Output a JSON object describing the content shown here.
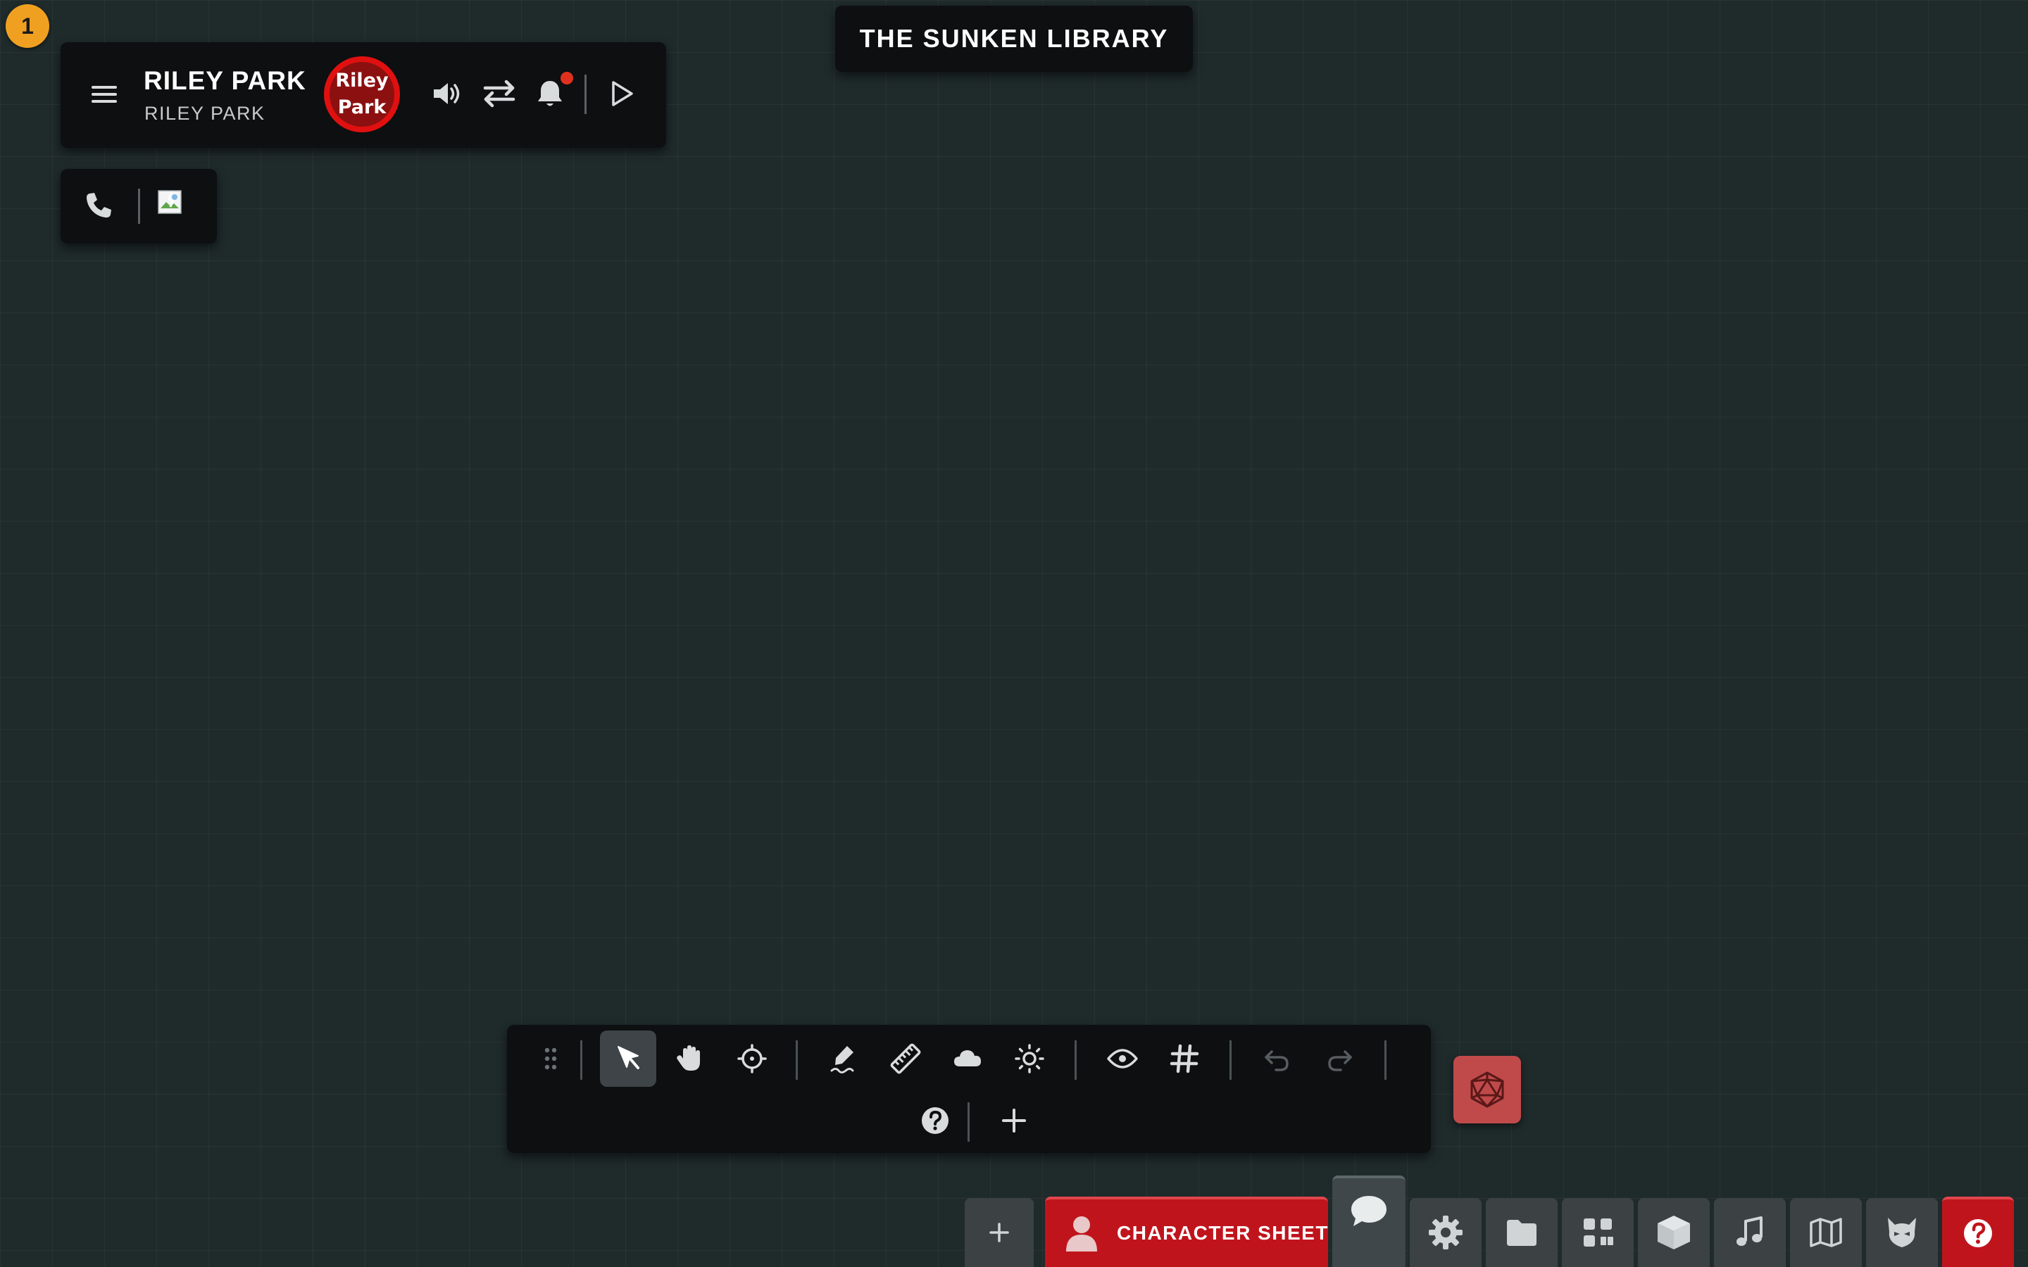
{
  "badge": {
    "count": "1"
  },
  "player": {
    "name": "RILEY PARK",
    "subtitle": "RILEY PARK",
    "avatar_line1": "Riley",
    "avatar_line2": "Park"
  },
  "scene": {
    "title": "THE SUNKEN LIBRARY"
  },
  "toolbar": {
    "row1": [
      "drag-handle",
      "select",
      "pan",
      "target",
      "draw",
      "measure",
      "fog",
      "light",
      "vision",
      "grid",
      "undo",
      "redo"
    ],
    "row2": [
      "help",
      "add"
    ],
    "active_tool": "select"
  },
  "bottom_bar": {
    "character_sheet_label": "CHARACTER SHEET",
    "tabs": [
      "add",
      "character-sheet",
      "chat",
      "settings",
      "files",
      "apps",
      "3d-dice",
      "music",
      "maps",
      "creatures",
      "help"
    ]
  },
  "colors": {
    "background": "#1f2a2b",
    "panel": "#0d0f10",
    "accent_red": "#c0141c",
    "badge": "#f0a020",
    "dice_button": "#c04a4a",
    "notification_dot": "#e0301e"
  }
}
